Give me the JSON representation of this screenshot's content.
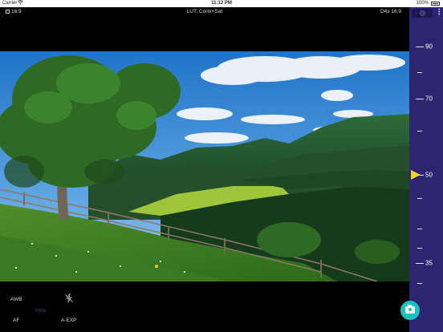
{
  "status_bar": {
    "carrier": "Carrier",
    "wifi_icon": "wifi-icon",
    "time": "11:12 PM",
    "battery": "100%",
    "battery_icon": "battery-icon"
  },
  "top_bar": {
    "aspect_left": "16:9",
    "lut": "LUT: Contr+Sat",
    "aspect_right": "D4s 16:9"
  },
  "viewport": {
    "scene": "photo-landscape"
  },
  "ruler": {
    "labels": [
      "90",
      "70",
      "50",
      "35"
    ],
    "pointer_value": "50",
    "pointer_color": "#f3d22b",
    "background_color": "#2d2570"
  },
  "bottom": {
    "awb_label": "AWB",
    "hide_label": "Hide",
    "af_label": "AF",
    "aexp_label": "A-EXP",
    "flash_icon": "flash-off-icon",
    "shutter_icon": "camera-icon",
    "shutter_color": "#17c2c0"
  }
}
